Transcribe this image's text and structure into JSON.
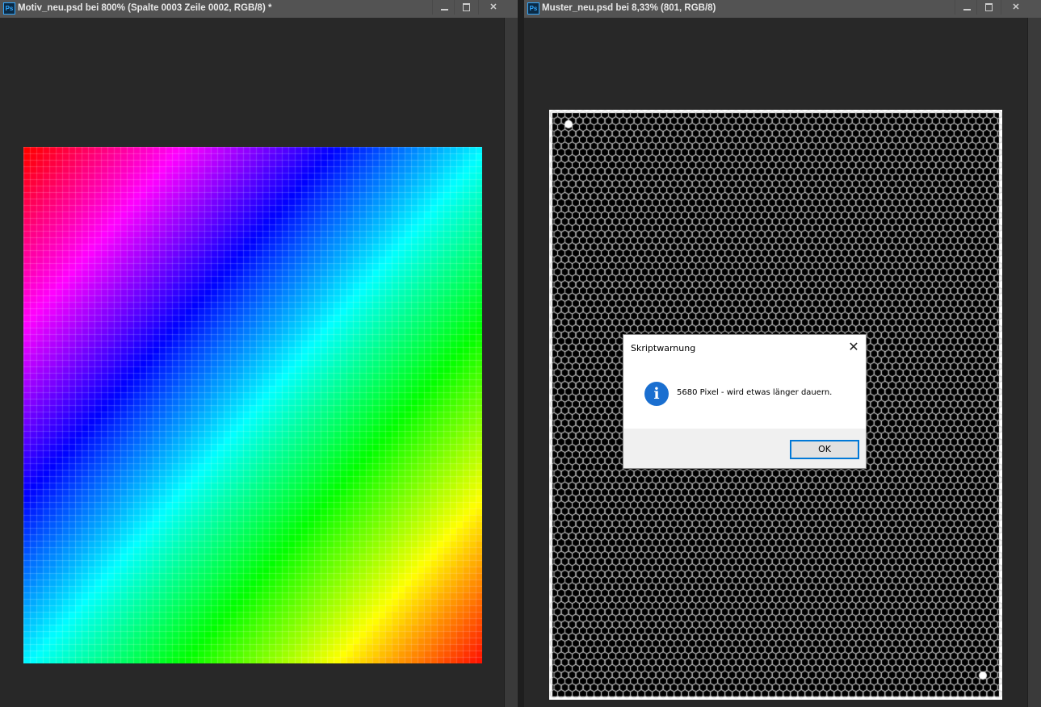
{
  "left_window": {
    "icon_label": "Ps",
    "title": "Motiv_neu.psd bei 800% (Spalte 0003 Zeile 0002, RGB/8) *",
    "buttons": [
      "minimize",
      "maximize",
      "close"
    ]
  },
  "right_window": {
    "icon_label": "Ps",
    "title": "Muster_neu.psd bei 8,33% (801, RGB/8)",
    "buttons": [
      "minimize",
      "maximize",
      "close"
    ]
  },
  "dialog": {
    "title": "Skriptwarnung",
    "close_glyph": "✕",
    "icon": "info-icon",
    "icon_glyph": "i",
    "message": "5680 Pixel - wird etwas länger dauern.",
    "ok_label": "OK"
  },
  "colors": {
    "app_background": "#282828",
    "titlebar": "#535353",
    "accent": "#0078d7"
  }
}
